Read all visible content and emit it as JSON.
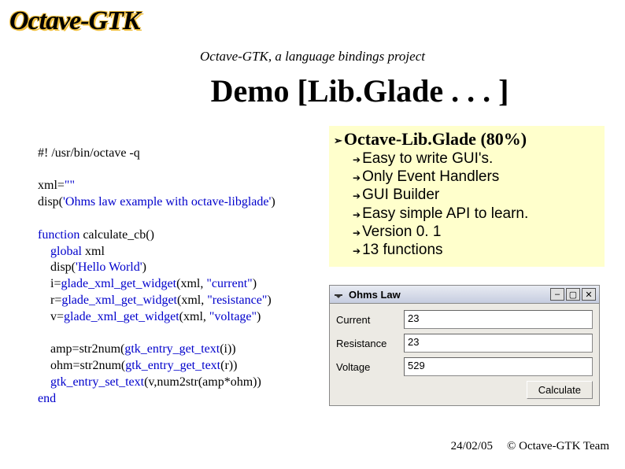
{
  "logo": "Octave-GTK",
  "subtitle": "Octave-GTK, a language bindings project",
  "title": "Demo  [Lib.Glade . . . ]",
  "code": {
    "line1": "#! /usr/bin/octave -q",
    "line3a": "xml=",
    "line3b": "\"\"",
    "line4a": "disp(",
    "line4b": "'Ohms law example with octave-libglade'",
    "line4c": ")",
    "line6a": "function",
    "line6b": " calculate_cb()",
    "line7a": "    global",
    "line7b": " xml",
    "line8a": "    disp(",
    "line8b": "'Hello World'",
    "line8c": ")",
    "line9a": "    i=",
    "line9b": "glade_xml_get_widget",
    "line9c": "(xml, ",
    "line9d": "\"current\"",
    "line9e": ")",
    "line10a": "    r=",
    "line10b": "glade_xml_get_widget",
    "line10c": "(xml, ",
    "line10d": "\"resistance\"",
    "line10e": ")",
    "line11a": "    v=",
    "line11b": "glade_xml_get_widget",
    "line11c": "(xml, ",
    "line11d": "\"voltage\"",
    "line11e": ")",
    "line13a": "    amp=str2num(",
    "line13b": "gtk_entry_get_text",
    "line13c": "(i))",
    "line14a": "    ohm=str2num(",
    "line14b": "gtk_entry_get_text",
    "line14c": "(r))",
    "line15a": "    ",
    "line15b": "gtk_entry_set_text",
    "line15c": "(v,num2str(amp*ohm))",
    "line16": "end"
  },
  "features": {
    "heading": "Octave-Lib.Glade (80%)",
    "items": [
      "Easy to write GUI's.",
      "Only Event Handlers",
      "GUI Builder",
      "Easy simple API to learn.",
      "Version 0. 1",
      "13 functions"
    ]
  },
  "gui": {
    "title": "Ohms Law",
    "rows": [
      {
        "label": "Current",
        "value": "23"
      },
      {
        "label": "Resistance",
        "value": "23"
      },
      {
        "label": "Voltage",
        "value": "529"
      }
    ],
    "button": "Calculate"
  },
  "footer": {
    "date": "24/02/05",
    "credit": "© Octave-GTK Team"
  }
}
